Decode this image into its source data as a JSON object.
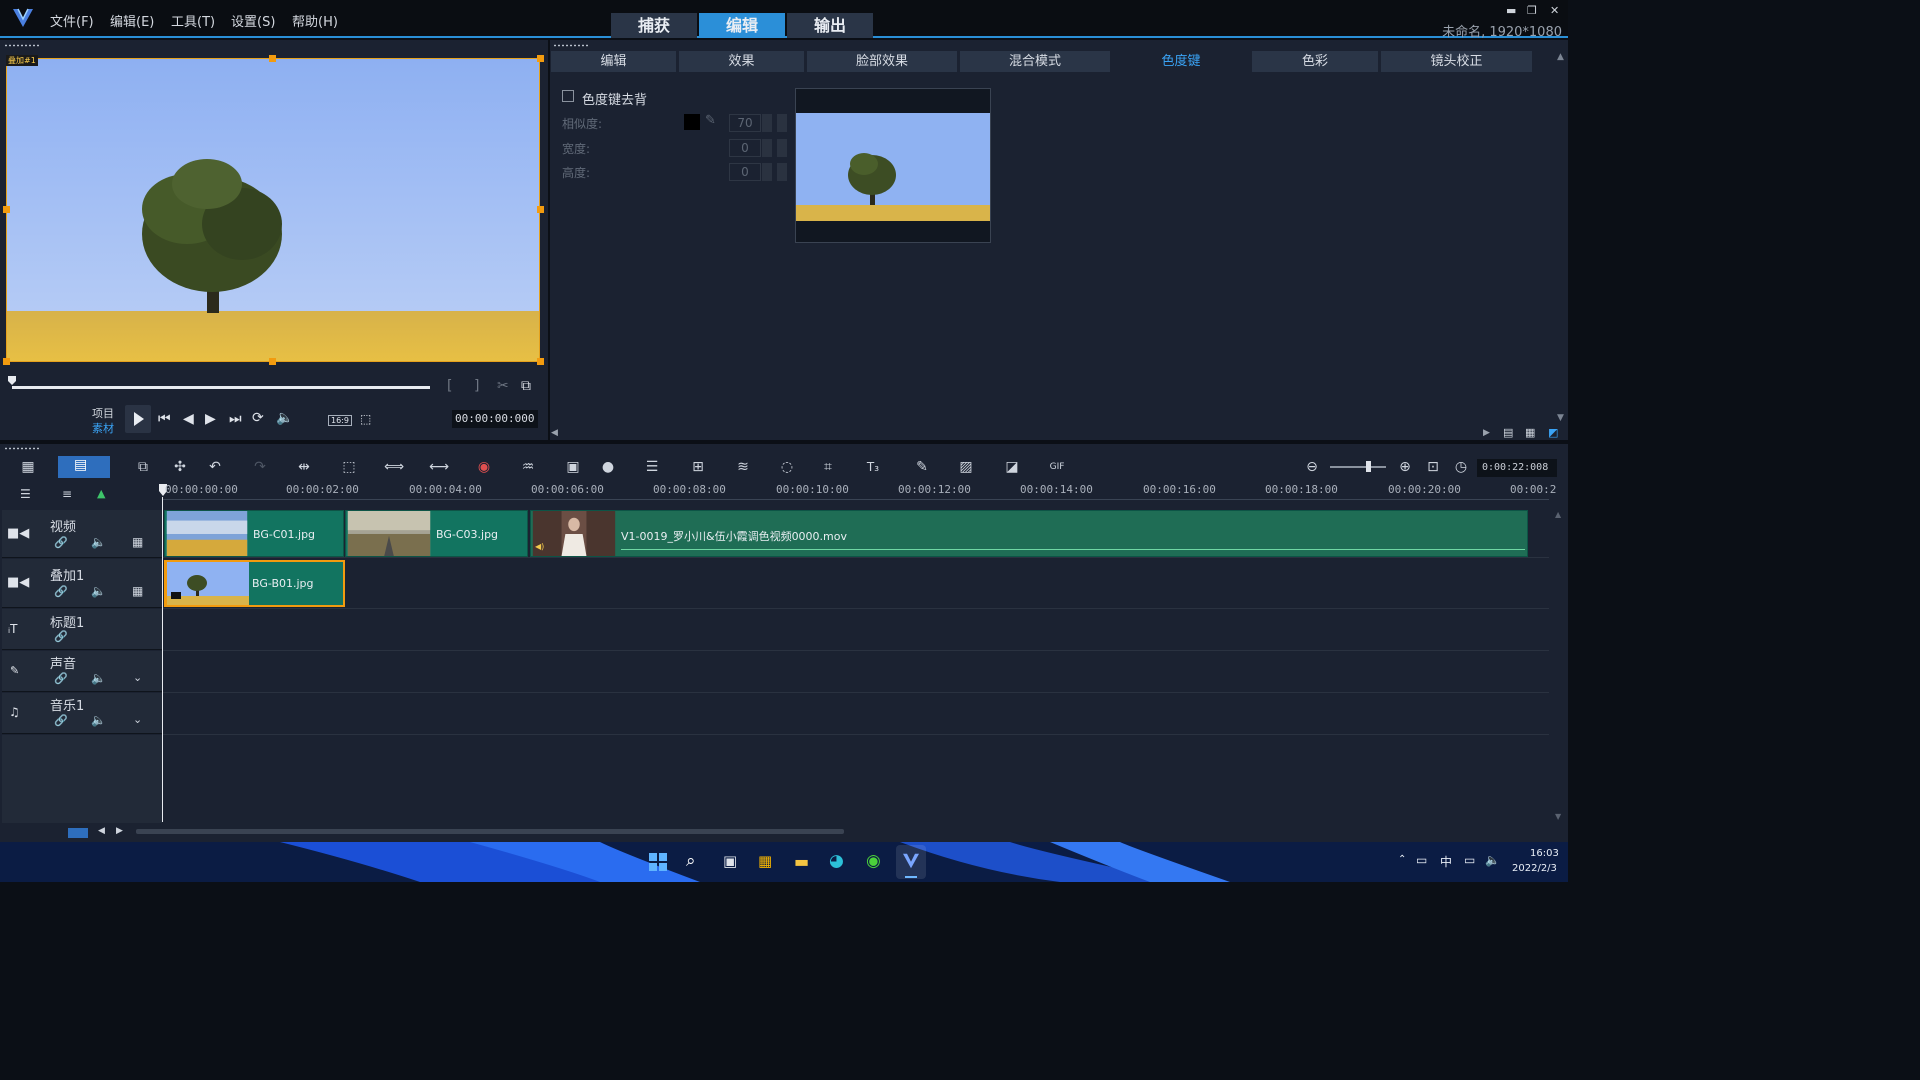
{
  "app": {
    "menu": [
      "文件(F)",
      "编辑(E)",
      "工具(T)",
      "设置(S)",
      "帮助(H)"
    ],
    "mode_tabs": [
      "捕获",
      "编辑",
      "输出"
    ],
    "active_mode": "编辑",
    "project_info": "未命名, 1920*1080",
    "accent": "#2b8fd8"
  },
  "preview": {
    "track_label": "叠加#1",
    "project_label": "项目",
    "clip_label": "素材",
    "timecode": "00:00:00:000",
    "aspect": "16:9"
  },
  "options": {
    "tabs": [
      "编辑",
      "效果",
      "脸部效果",
      "混合模式",
      "色度键",
      "色彩",
      "镜头校正"
    ],
    "active_tab": "色度键",
    "chroma_checkbox_label": "色度键去背",
    "similarity_label": "相似度:",
    "similarity_value": "70",
    "width_label": "宽度:",
    "width_value": "0",
    "height_label": "高度:",
    "height_value": "0"
  },
  "timeline": {
    "duration": "0:00:22:008",
    "ruler": [
      "00:00:00:00",
      "00:00:02:00",
      "00:00:04:00",
      "00:00:06:00",
      "00:00:08:00",
      "00:00:10:00",
      "00:00:12:00",
      "00:00:14:00",
      "00:00:16:00",
      "00:00:18:00",
      "00:00:20:00",
      "00:00:2"
    ],
    "tracks": [
      "视频",
      "叠加1",
      "标题1",
      "声音",
      "音乐1"
    ],
    "video_clips": [
      "BG-C01.jpg",
      "BG-C03.jpg",
      "V1-0019_罗小川&伍小霞调色视频0000.mov"
    ],
    "overlay_clips": [
      "BG-B01.jpg"
    ]
  },
  "taskbar": {
    "ime": "中",
    "time": "16:03",
    "date": "2022/2/3"
  }
}
